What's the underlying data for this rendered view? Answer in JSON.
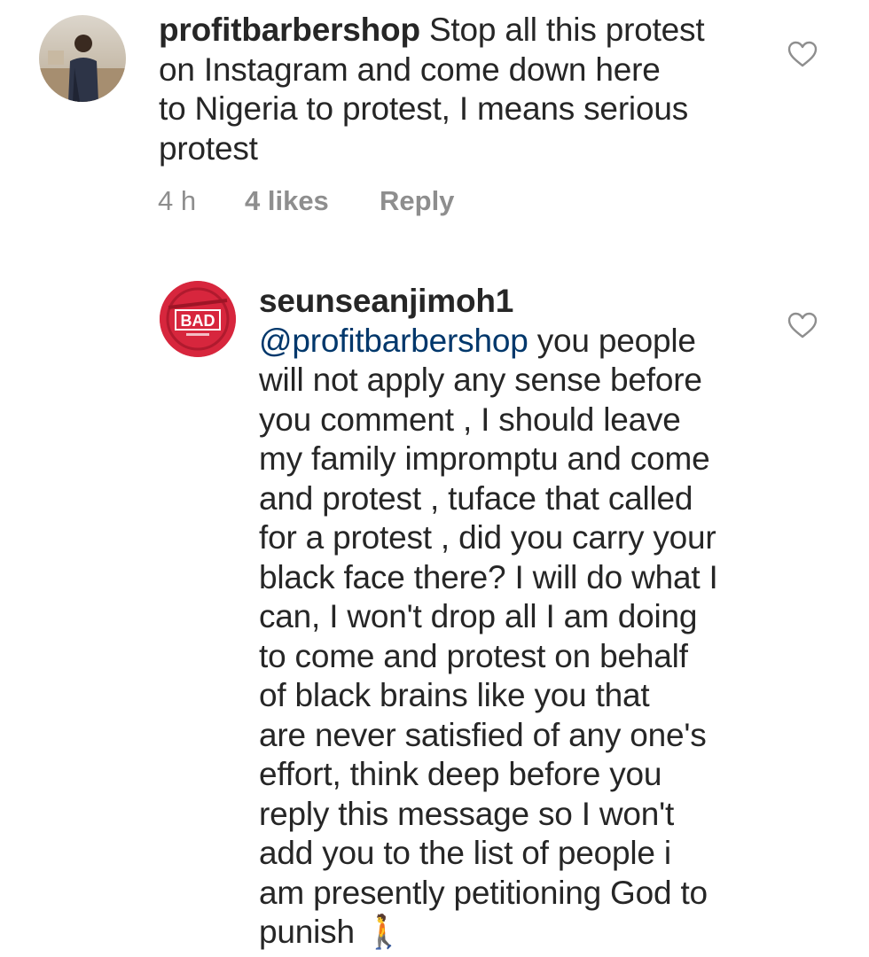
{
  "comments": [
    {
      "username": "profitbarbershop",
      "lines": [
        " Stop all this protest",
        "on Instagram and come down here",
        "to Nigeria to protest, I means serious",
        "protest"
      ],
      "time": "4 h",
      "likes": "4 likes",
      "reply": "Reply",
      "like_icon": "heart-outline-icon"
    },
    {
      "username": "seunseanjimoh1",
      "mention": "@profitbarbershop",
      "lines": [
        " you people",
        "will not apply any sense before",
        "you comment , I should leave",
        "my family impromptu and come",
        "and protest , tuface that called",
        "for a protest , did you carry your",
        "black face there? I will do what I",
        "can, I won't  drop all I am doing",
        "to come and protest on behalf",
        "of black brains like you that",
        "are never satisfied of any one's",
        "effort,  think deep before you",
        "reply this message so I won't",
        "add you to the list of people i",
        "am presently petitioning God to",
        "punish "
      ],
      "emoji": "🚶",
      "avatar_logo": "BAD",
      "like_icon": "heart-outline-icon"
    }
  ],
  "colors": {
    "text": "#262626",
    "meta": "#8e8e8e",
    "mention": "#00376b",
    "logo_red": "#d7263d"
  }
}
